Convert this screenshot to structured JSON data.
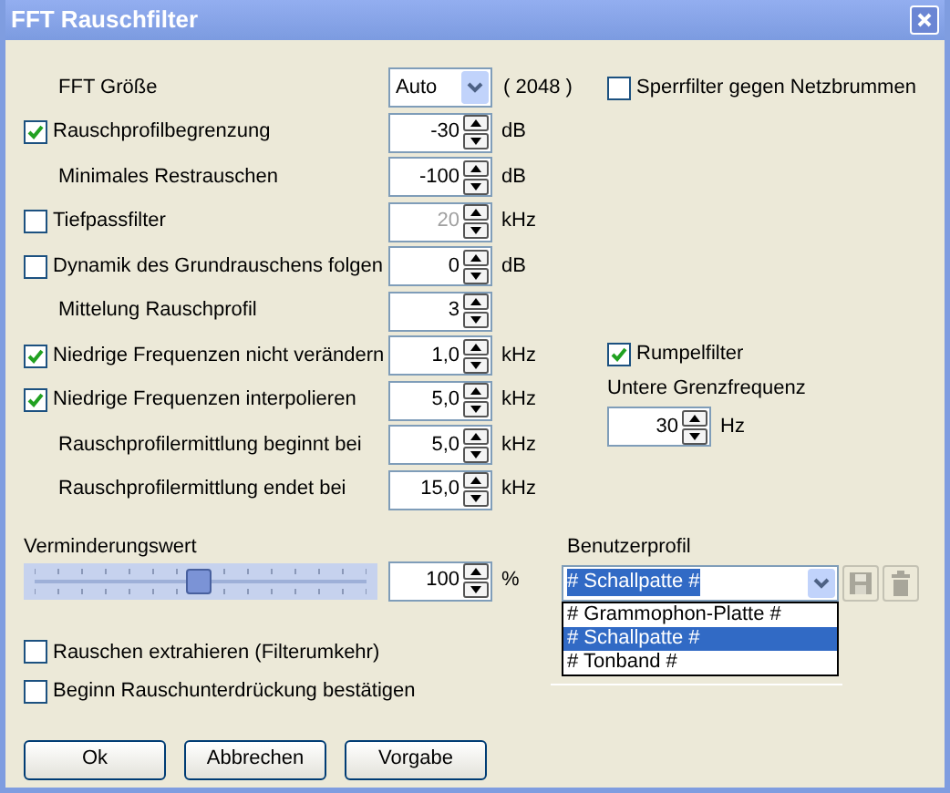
{
  "window": {
    "title": "FFT Rauschfilter"
  },
  "fft": {
    "label": "FFT Größe",
    "value": "Auto",
    "extra": "( 2048 )"
  },
  "settings": [
    {
      "kind": "checkbox",
      "label": "Rauschprofilbegrenzung",
      "checked": true,
      "value": "-30",
      "unit": "dB",
      "disabled": false
    },
    {
      "kind": "label",
      "label": "Minimales Restrauschen",
      "value": "-100",
      "unit": "dB",
      "disabled": false
    },
    {
      "kind": "checkbox",
      "label": "Tiefpassfilter",
      "checked": false,
      "value": "20",
      "unit": "kHz",
      "disabled": true
    },
    {
      "kind": "checkbox",
      "label": "Dynamik des Grundrauschens folgen",
      "checked": false,
      "value": "0",
      "unit": "dB",
      "disabled": false
    },
    {
      "kind": "label",
      "label": "Mittelung Rauschprofil",
      "value": "3",
      "disabled": false
    },
    {
      "kind": "checkbox",
      "label": "Niedrige Frequenzen nicht verändern",
      "checked": true,
      "value": "1,0",
      "unit": "kHz",
      "disabled": false
    },
    {
      "kind": "checkbox",
      "label": "Niedrige Frequenzen interpolieren",
      "checked": true,
      "value": "5,0",
      "unit": "kHz",
      "disabled": false
    },
    {
      "kind": "label",
      "label": "Rauschprofilermittlung beginnt bei",
      "value": "5,0",
      "unit": "kHz",
      "disabled": false
    },
    {
      "kind": "label",
      "label": "Rauschprofilermittlung endet bei",
      "value": "15,0",
      "unit": "kHz",
      "disabled": false
    }
  ],
  "hum_filter": {
    "label": "Sperrfilter gegen Netzbrummen",
    "checked": false
  },
  "rumble_filter": {
    "label": "Rumpelfilter",
    "checked": true,
    "cutoff_label": "Untere Grenzfrequenz",
    "value": "30",
    "unit": "Hz"
  },
  "reduction": {
    "label": "Verminderungswert",
    "level": 0.5,
    "value": "100",
    "unit": "%"
  },
  "profile": {
    "label": "Benutzerprofil",
    "value": "# Schallpatte #",
    "options": [
      {
        "label": "# Grammophon-Platte #",
        "selected": false
      },
      {
        "label": "# Schallpatte #",
        "selected": true
      },
      {
        "label": "# Tonband #",
        "selected": false
      }
    ]
  },
  "options": [
    {
      "label": "Rauschen extrahieren (Filterumkehr)",
      "checked": false
    },
    {
      "label": "Beginn Rauschunterdrückung bestätigen",
      "checked": false
    }
  ],
  "buttons": [
    "Ok",
    "Abbrechen",
    "Vorgabe"
  ]
}
